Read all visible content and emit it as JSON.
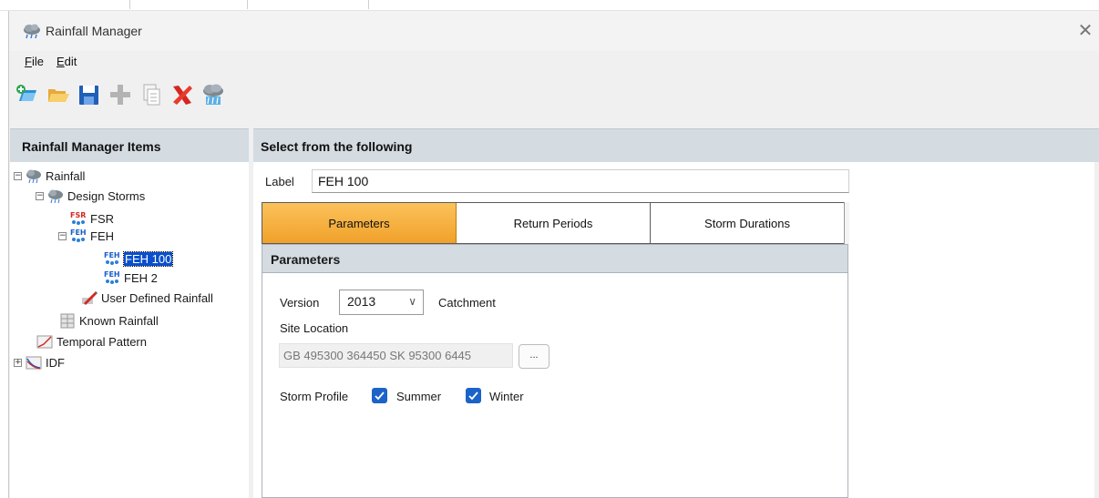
{
  "window": {
    "title": "Rainfall Manager",
    "close_glyph": "✕"
  },
  "menu": {
    "file": {
      "accel": "F",
      "rest": "ile"
    },
    "edit": {
      "accel": "E",
      "rest": "dit"
    }
  },
  "toolbar": {
    "buttons": [
      {
        "name": "new-icon"
      },
      {
        "name": "open-folder-icon"
      },
      {
        "name": "save-icon"
      },
      {
        "name": "add-icon"
      },
      {
        "name": "copy-icon"
      },
      {
        "name": "delete-icon"
      },
      {
        "name": "rainfall-icon"
      }
    ]
  },
  "left_panel": {
    "header": "Rainfall Manager Items"
  },
  "tree": {
    "rainfall": "Rainfall",
    "design_storms": "Design Storms",
    "fsr": "FSR",
    "feh": "FEH",
    "feh100": "FEH 100",
    "feh2": "FEH 2",
    "user_defined": "User Defined Rainfall",
    "known": "Known Rainfall",
    "temporal": "Temporal Pattern",
    "idf": "IDF",
    "expander_open": "−",
    "expander_closed": "+"
  },
  "right_panel": {
    "header": "Select from the following",
    "label_caption": "Label",
    "label_value": "FEH 100"
  },
  "tabs": {
    "parameters": "Parameters",
    "return_periods": "Return Periods",
    "storm_durations": "Storm Durations"
  },
  "params": {
    "header": "Parameters",
    "version_label": "Version",
    "version_value": "2013",
    "version_chevron": "∨",
    "catchment_label": "Catchment",
    "site_location_label": "Site Location",
    "site_location_value": "GB 495300 364450 SK 95300 6445",
    "browse_label": "...",
    "storm_profile_label": "Storm Profile",
    "summer_label": "Summer",
    "winter_label": "Winter",
    "summer_checked": true,
    "winter_checked": true
  },
  "colors": {
    "accent": "#1b63c9",
    "selected": "#0a4fcc",
    "tab_active": "#f1a12a",
    "header_bg": "#d4dbe1"
  }
}
